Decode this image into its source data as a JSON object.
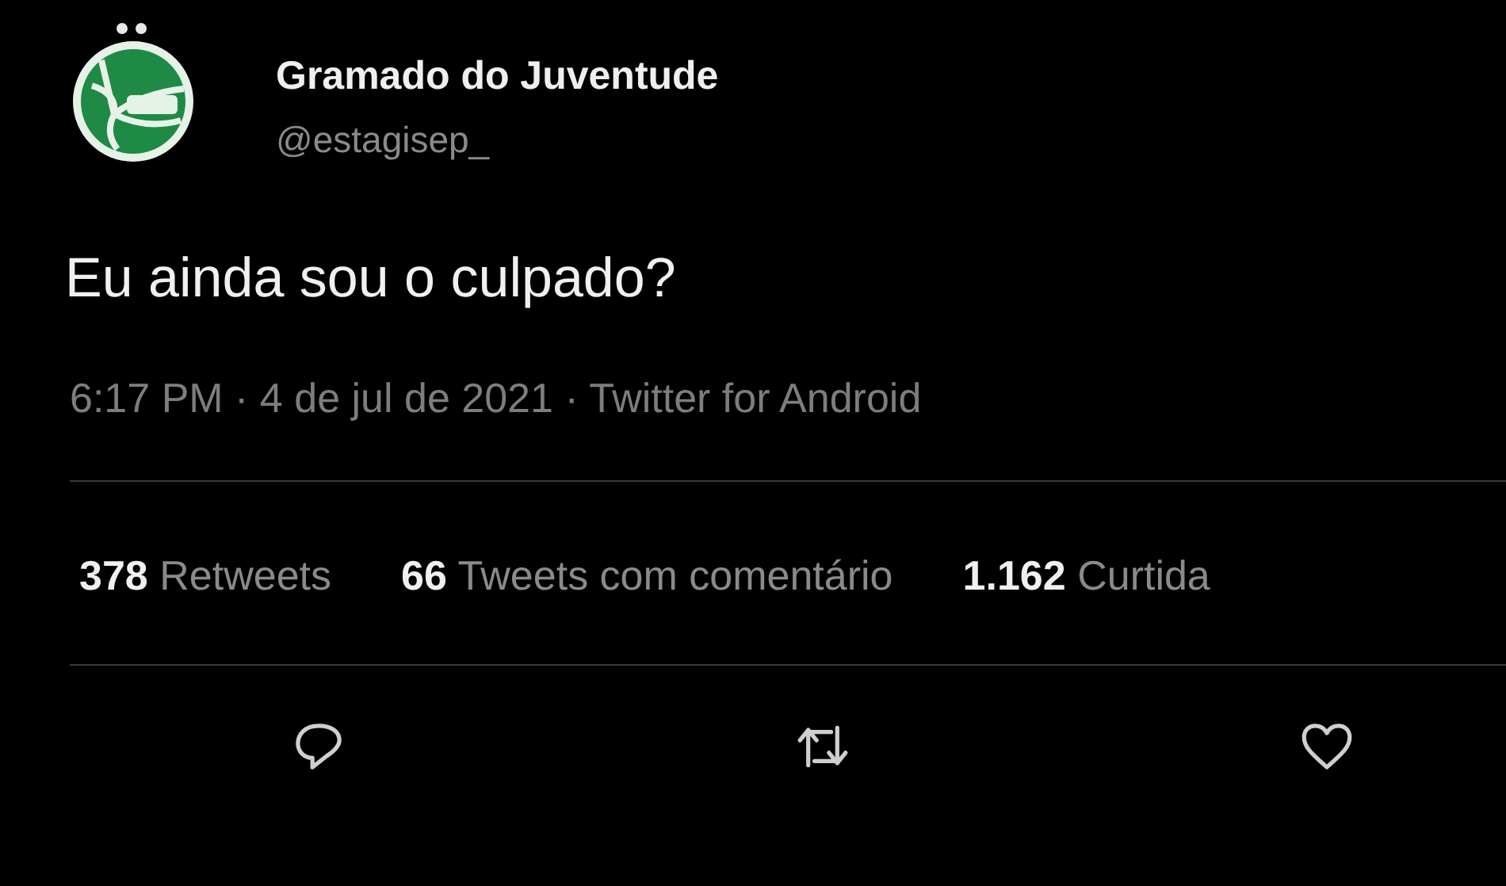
{
  "author": {
    "name": "Gramado do Juventude",
    "handle": "@estagisep_"
  },
  "tweet": {
    "text": "Eu ainda sou o culpado?"
  },
  "meta": "6:17 PM · 4 de jul de 2021 · Twitter for Android",
  "stats": [
    {
      "count": "378",
      "label": "Retweets"
    },
    {
      "count": "66",
      "label": "Tweets com comentário"
    },
    {
      "count": "1.162",
      "label": "Curtida"
    }
  ],
  "actions": [
    {
      "kind": "reply"
    },
    {
      "kind": "retweet"
    },
    {
      "kind": "like"
    }
  ]
}
